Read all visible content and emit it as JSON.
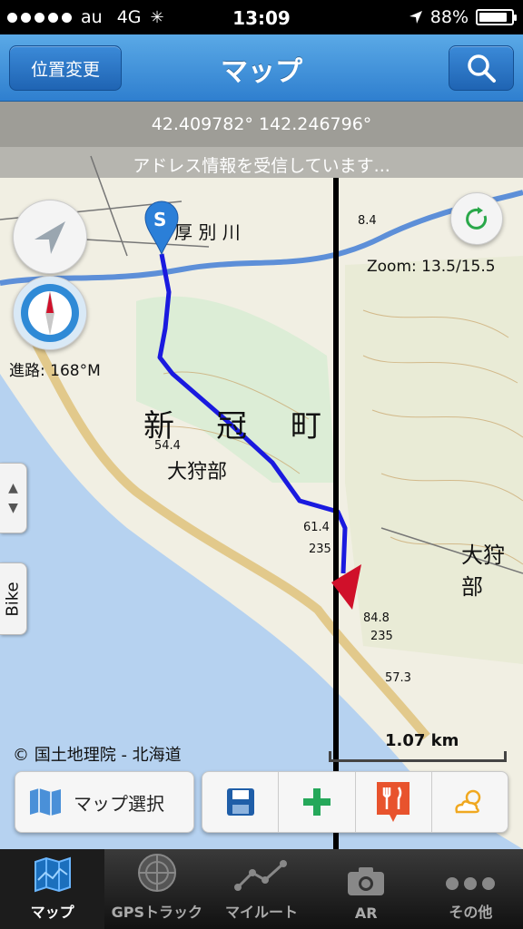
{
  "status_bar": {
    "carrier": "au",
    "network": "4G",
    "time": "13:09",
    "battery_percent": "88%",
    "battery_level": 0.88,
    "icons": [
      "signal-dots-icon",
      "activity-spinner-icon",
      "location-arrow-icon",
      "battery-icon"
    ]
  },
  "navbar": {
    "left_button": "位置変更",
    "title": "マップ",
    "right_button_icon": "search-icon"
  },
  "map": {
    "coordinates": "42.409782° 142.246796°",
    "address_status": "アドレス情報を受信しています...",
    "zoom": "Zoom: 13.5/15.5",
    "heading": "進路: 168°M",
    "copyright": "© 国土地理院 - 北海道",
    "scale": "1.07 km",
    "start_marker": "S",
    "labels": {
      "town_char_1": "新",
      "town_char_2": "冠",
      "town_char_3": "町",
      "area_1": "大狩部",
      "area_2": "大狩部",
      "river": "厚 別 川",
      "elev_1": "54.4",
      "elev_2": "61.4",
      "elev_3": "84.8",
      "elev_4": "57.3",
      "elev_5": "8.4",
      "route_1": "235",
      "route_2": "235"
    },
    "side_tab_bike": "Bike",
    "map_select_label": "マップ選択",
    "toolbar_icons": [
      "save-icon",
      "add-icon",
      "restaurant-icon",
      "weather-icon"
    ]
  },
  "tabbar": {
    "tabs": [
      {
        "label": "マップ",
        "icon": "map-icon",
        "active": true
      },
      {
        "label": "GPSトラック",
        "icon": "radar-icon",
        "active": false
      },
      {
        "label": "マイルート",
        "icon": "route-icon",
        "active": false
      },
      {
        "label": "AR",
        "icon": "camera-icon",
        "active": false
      },
      {
        "label": "その他",
        "icon": "more-icon",
        "active": false
      }
    ]
  },
  "colors": {
    "navbar": "#2f7fcf",
    "route": "#1a1adf",
    "sea": "#b6d2f0",
    "marker": "#d0102a"
  }
}
